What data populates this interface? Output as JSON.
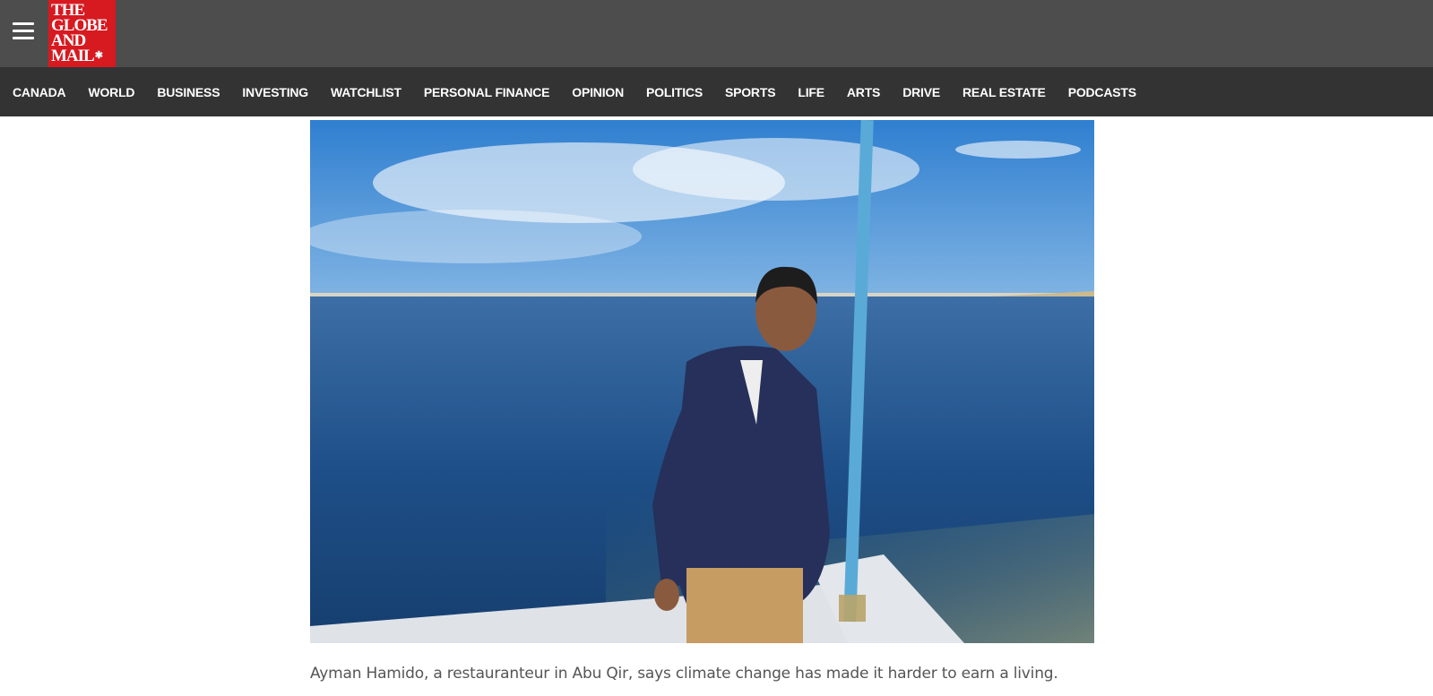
{
  "header": {
    "menu_icon": "hamburger-menu-icon",
    "logo": {
      "lines": [
        "THE",
        "GLOBE",
        "AND",
        "MAIL"
      ],
      "icon": "maple-leaf-icon",
      "color": "#d71920"
    }
  },
  "nav": {
    "items": [
      "CANADA",
      "WORLD",
      "BUSINESS",
      "INVESTING",
      "WATCHLIST",
      "PERSONAL FINANCE",
      "OPINION",
      "POLITICS",
      "SPORTS",
      "LIFE",
      "ARTS",
      "DRIVE",
      "REAL ESTATE",
      "PODCASTS"
    ]
  },
  "article": {
    "caption": "Ayman Hamido, a restauranteur in Abu Qir, says climate change has made it harder to earn a living."
  },
  "colors": {
    "topbar": "#4d4d4d",
    "navbar": "#333333",
    "brand_red": "#d71920"
  }
}
